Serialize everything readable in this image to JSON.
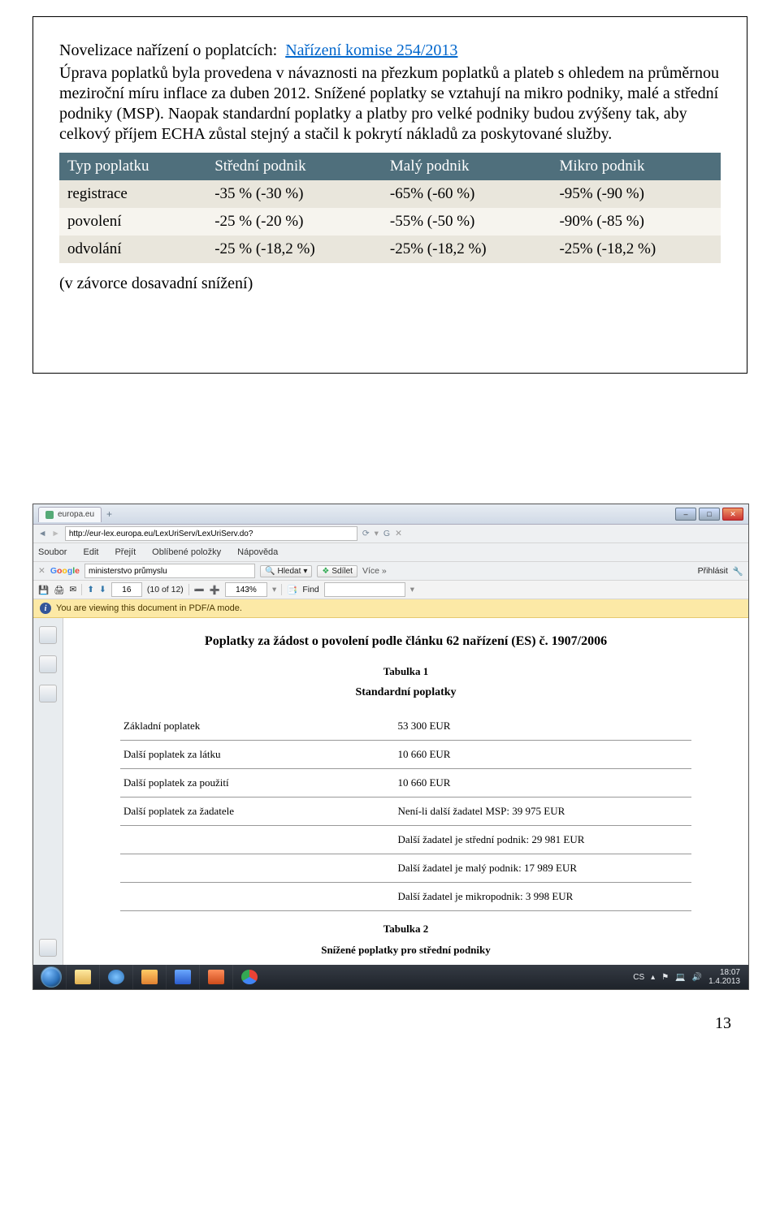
{
  "slide": {
    "title_plain": "Novelizace nařízení o poplatcích:",
    "title_link": "Nařízení komise 254/2013",
    "para1": "Úprava poplatků byla provedena v návaznosti na přezkum poplatků a plateb s ohledem na průměrnou meziroční míru inflace za duben 2012. Snížené poplatky se vztahují na mikro podniky, malé a střední podniky (MSP). Naopak standardní poplatky a platby pro velké podniky budou zvýšeny tak, aby celkový příjem ECHA zůstal stejný a stačil k pokrytí nákladů za poskytované služby.",
    "table": {
      "headers": [
        "Typ poplatku",
        "Střední podnik",
        "Malý podnik",
        "Mikro podnik"
      ],
      "rows": [
        [
          "registrace",
          "-35 % (-30 %)",
          "-65% (-60 %)",
          "-95% (-90 %)"
        ],
        [
          "povolení",
          "-25 % (-20 %)",
          "-55% (-50 %)",
          "-90% (-85 %)"
        ],
        [
          "odvolání",
          "-25 % (-18,2 %)",
          "-25% (-18,2 %)",
          "-25% (-18,2 %)"
        ]
      ]
    },
    "note": "(v závorce dosavadní snížení)"
  },
  "browser": {
    "tab": "europa.eu",
    "url": "http://eur-lex.europa.eu/LexUriServ/LexUriServ.do?",
    "menu": {
      "soubor": "Soubor",
      "edit": "Edit",
      "prejit": "Přejít",
      "oblibene": "Oblíbené položky",
      "napoveda": "Nápověda"
    },
    "google": {
      "brand": "Google",
      "search_value": "ministerstvo průmyslu",
      "hledat": "Hledat",
      "sdilet": "Sdílet",
      "vice": "Více »",
      "prihlasit": "Přihlásit"
    },
    "pdfbar": {
      "page": "16",
      "page_of": "(10 of 12)",
      "zoom": "143%",
      "find": "Find"
    },
    "notice": "You are viewing this document in PDF/A mode.",
    "pdf": {
      "heading": "Poplatky za žádost o povolení podle článku 62 nařízení (ES) č. 1907/2006",
      "t1": "Tabulka 1",
      "t1sub": "Standardní poplatky",
      "rows": [
        [
          "Základní poplatek",
          "53 300 EUR"
        ],
        [
          "Další poplatek za látku",
          "10 660 EUR"
        ],
        [
          "Další poplatek za použití",
          "10 660 EUR"
        ],
        [
          "Další poplatek za žadatele",
          "Není-li další žadatel MSP: 39 975 EUR"
        ],
        [
          "",
          "Další žadatel je střední podnik: 29 981 EUR"
        ],
        [
          "",
          "Další žadatel je malý podnik: 17 989 EUR"
        ],
        [
          "",
          "Další žadatel je mikropodnik: 3 998 EUR"
        ]
      ],
      "t2": "Tabulka 2",
      "t2sub": "Snížené poplatky pro střední podniky"
    },
    "tray": {
      "lang": "CS",
      "time": "18:07",
      "date": "1.4.2013"
    }
  },
  "chart_data": {
    "type": "table",
    "title": "Snížení poplatků podle typu poplatku a velikosti podniku (v závorce dosavadní snížení)",
    "columns": [
      "Typ poplatku",
      "Střední podnik",
      "Malý podnik",
      "Mikro podnik"
    ],
    "rows": [
      {
        "Typ poplatku": "registrace",
        "Střední podnik": "-35 % (-30 %)",
        "Malý podnik": "-65% (-60 %)",
        "Mikro podnik": "-95% (-90 %)"
      },
      {
        "Typ poplatku": "povolení",
        "Střední podnik": "-25 % (-20 %)",
        "Malý podnik": "-55% (-50 %)",
        "Mikro podnik": "-90% (-85 %)"
      },
      {
        "Typ poplatku": "odvolání",
        "Střední podnik": "-25 % (-18,2 %)",
        "Malý podnik": "-25% (-18,2 %)",
        "Mikro podnik": "-25% (-18,2 %)"
      }
    ]
  },
  "page_number": "13"
}
